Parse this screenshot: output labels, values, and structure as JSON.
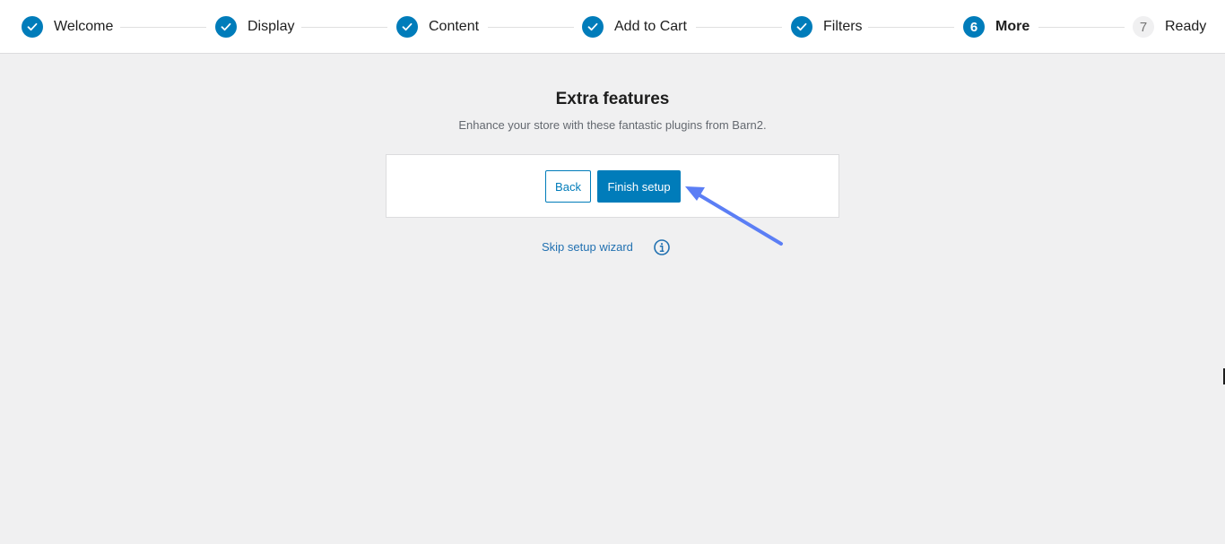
{
  "stepper": {
    "steps": [
      {
        "label": "Welcome",
        "state": "done",
        "number": ""
      },
      {
        "label": "Display",
        "state": "done",
        "number": ""
      },
      {
        "label": "Content",
        "state": "done",
        "number": ""
      },
      {
        "label": "Add to Cart",
        "state": "done",
        "number": ""
      },
      {
        "label": "Filters",
        "state": "done",
        "number": ""
      },
      {
        "label": "More",
        "state": "current",
        "number": "6"
      },
      {
        "label": "Ready",
        "state": "pending",
        "number": "7"
      }
    ]
  },
  "main": {
    "title": "Extra features",
    "subtitle": "Enhance your store with these fantastic plugins from Barn2.",
    "back_label": "Back",
    "finish_label": "Finish setup",
    "skip_label": "Skip setup wizard"
  },
  "colors": {
    "accent": "#007cba",
    "annotation_arrow": "#5b7ef5",
    "page_background": "#f0f0f1"
  },
  "icons": {
    "done_step": "check-icon",
    "skip_info": "info-icon"
  }
}
